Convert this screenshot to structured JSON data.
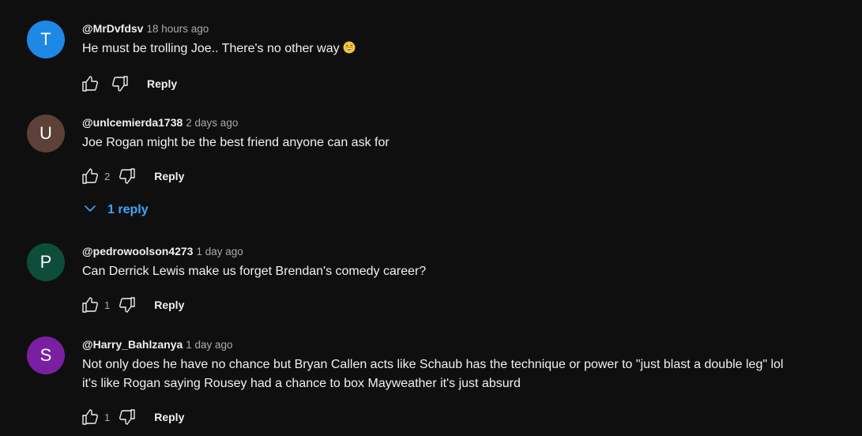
{
  "comments": [
    {
      "avatar_letter": "T",
      "avatar_color": "#1e88e5",
      "author": "@MrDvfdsv",
      "time": "18 hours ago",
      "text": "He must be trolling Joe.. There's no other way",
      "emoji": "grinning-sweat-emoji",
      "likes": "",
      "reply_label": "Reply"
    },
    {
      "avatar_letter": "U",
      "avatar_color": "#5d4037",
      "author": "@unlcemierda1738",
      "time": "2 days ago",
      "text": "Joe Rogan might be the best friend anyone can ask for",
      "likes": "2",
      "reply_label": "Reply",
      "replies_label": "1 reply"
    },
    {
      "avatar_letter": "P",
      "avatar_color": "#0d4d3a",
      "author": "@pedrowoolson4273",
      "time": "1 day ago",
      "text": "Can Derrick Lewis make us forget Brendan's comedy career?",
      "likes": "1",
      "reply_label": "Reply"
    },
    {
      "avatar_letter": "S",
      "avatar_color": "#7b1fa2",
      "author": "@Harry_Bahlzanya",
      "time": "1 day ago",
      "text_line1": "Not only does he have no chance but Bryan Callen acts like Schaub has the technique or power to \"just blast a double leg\" lol",
      "text_line2": "it's like Rogan saying Rousey had a chance to box Mayweather it's just absurd",
      "likes": "1",
      "reply_label": "Reply"
    }
  ],
  "icons": {
    "like": "thumbs-up-icon",
    "dislike": "thumbs-down-icon",
    "expand": "chevron-down-icon"
  },
  "colors": {
    "background": "#0f0f0f",
    "text": "#f1f1f1",
    "secondary_text": "#aaaaaa",
    "link": "#3ea6ff"
  }
}
